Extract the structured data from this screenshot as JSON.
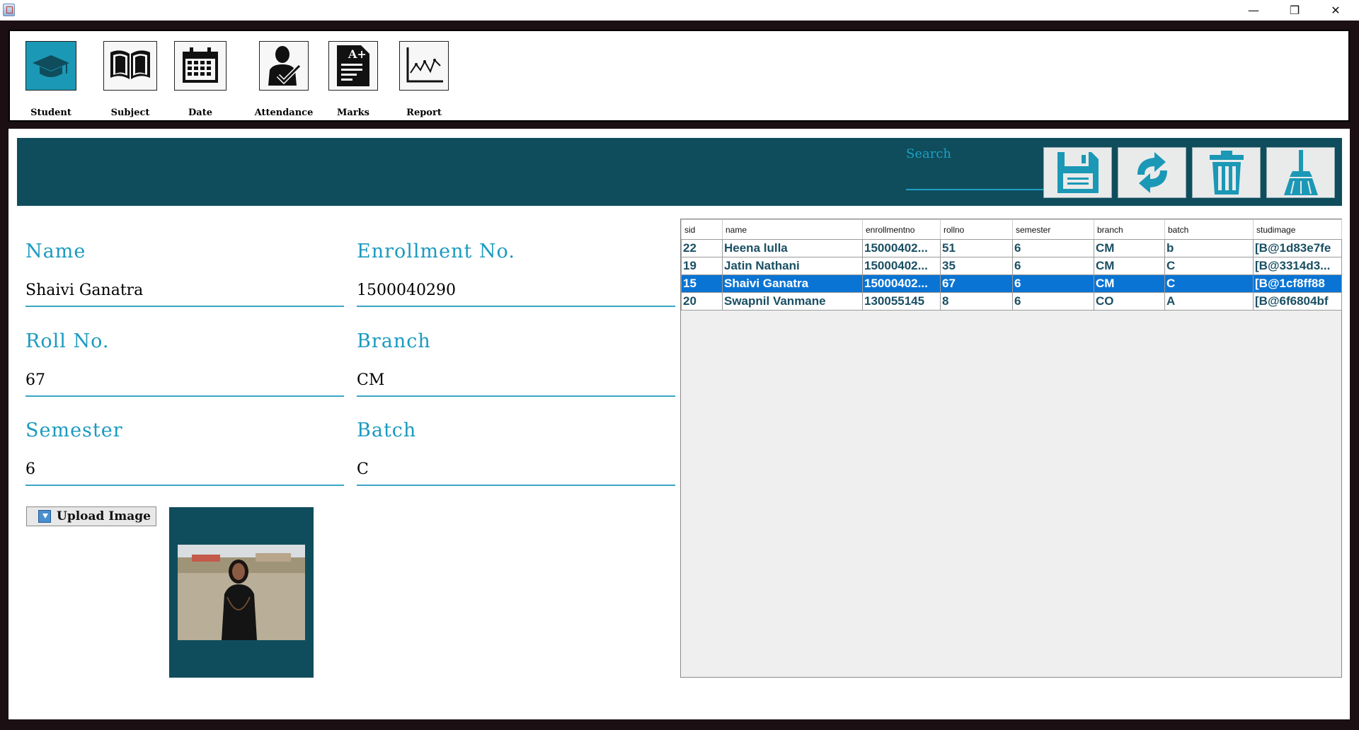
{
  "toolbar": {
    "items": [
      {
        "label": "Student",
        "icon": "graduation-cap-icon"
      },
      {
        "label": "Subject",
        "icon": "open-book-icon"
      },
      {
        "label": "Date",
        "icon": "calendar-icon"
      },
      {
        "label": "Attendance",
        "icon": "person-check-icon"
      },
      {
        "label": "Marks",
        "icon": "marks-sheet-icon"
      },
      {
        "label": "Report",
        "icon": "line-chart-icon"
      }
    ]
  },
  "header": {
    "search_label": "Search",
    "search_value": "",
    "actions": [
      {
        "name": "save",
        "icon": "floppy-disk-icon"
      },
      {
        "name": "refresh",
        "icon": "refresh-arrows-icon"
      },
      {
        "name": "delete",
        "icon": "trash-icon"
      },
      {
        "name": "clear",
        "icon": "broom-icon"
      }
    ],
    "accent_color": "#0f4d5c"
  },
  "form": {
    "name_label": "Name",
    "name_value": "Shaivi Ganatra",
    "enrollment_label": "Enrollment No.",
    "enrollment_value": "1500040290",
    "rollno_label": "Roll No.",
    "rollno_value": "67",
    "branch_label": "Branch",
    "branch_value": "CM",
    "semester_label": "Semester",
    "semester_value": "6",
    "batch_label": "Batch",
    "batch_value": "C",
    "upload_label": "Upload Image"
  },
  "table": {
    "columns": [
      "sid",
      "name",
      "enrollmentno",
      "rollno",
      "semester",
      "branch",
      "batch",
      "studimage"
    ],
    "rows": [
      [
        "22",
        "Heena lulla",
        "15000402...",
        "51",
        "6",
        "CM",
        "b",
        "[B@1d83e7fe"
      ],
      [
        "19",
        "Jatin Nathani",
        "15000402...",
        "35",
        "6",
        "CM",
        "C",
        "[B@3314d3..."
      ],
      [
        "15",
        "Shaivi Ganatra",
        "15000402...",
        "67",
        "6",
        "CM",
        "C",
        "[B@1cf8ff88"
      ],
      [
        "20",
        "Swapnil Vanmane",
        "130055145",
        "8",
        "6",
        "CO",
        "A",
        "[B@6f6804bf"
      ]
    ],
    "selected_row": 2,
    "selected_color": "#0a74d4"
  }
}
